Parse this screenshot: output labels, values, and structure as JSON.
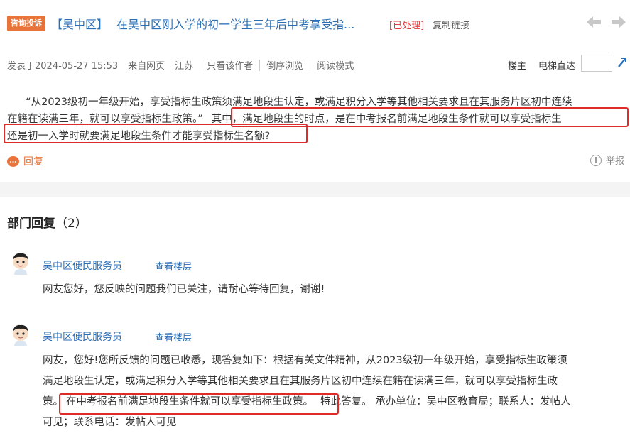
{
  "header": {
    "tag": "咨询投诉",
    "district": "【吴中区】",
    "title": "在吴中区刚入学的初一学生三年后中考享受指...",
    "status": "[已处理]",
    "copy_link": "复制链接",
    "prev_icon": "arrow-left-icon",
    "next_icon": "arrow-right-icon"
  },
  "meta": {
    "posted": "发表于2024-05-27 15:53",
    "source": "来自网页",
    "region": "江苏",
    "only_author": "只看该作者",
    "reverse": "倒序浏览",
    "reading_mode": "阅读模式",
    "owner": "楼主",
    "elevator": "电梯直达",
    "floor_value": "",
    "jump_icon": "jump-icon"
  },
  "post": {
    "line1": "“从2023级初一年级开始，享受指标生政策须满足地段生认定，或满足积分入学等其他相关要求且在其服务片区初中连续",
    "line2a": "在籍在读满三年，就可以享受指标生政策。”",
    "line2b": "其中，满足地段生的时点，是在中考报名前满足地段生条件就可以享受指标生",
    "line3": "还是初一入学时就要满足地段生条件才能享受指标生名额?",
    "reply": "回复",
    "report": "举报"
  },
  "dept": {
    "title": "部门回复",
    "count": "（2）"
  },
  "replies": [
    {
      "author": "吴中区便民服务员",
      "floor": "查看楼层",
      "text": "网友您好，您反映的问题我们已关注，请耐心等待回复，谢谢!"
    },
    {
      "author": "吴中区便民服务员",
      "floor": "查看楼层",
      "line1": "网友，您好!您所反馈的问题已收悉，现答复如下：根据有关文件精神，从2023级初一年级开始，享受指标生政策须",
      "line2": "满足地段生认定，或满足积分入学等其他相关要求且在其服务片区初中连续在籍在读满三年，就可以享受指标生政",
      "line3a": "策。",
      "line3b": "在中考报名前满足地段生条件就可以享受指标生政策。",
      "line3c": "特此答复。 承办单位：吴中区教育局；联系人：发帖人",
      "line4": "可见；联系电话：发帖人可见"
    }
  ],
  "colors": {
    "tag_bg": "#e8743b",
    "link": "#2a6eb5",
    "status": "#e03c3c",
    "highlight_border": "#e02b2b"
  }
}
